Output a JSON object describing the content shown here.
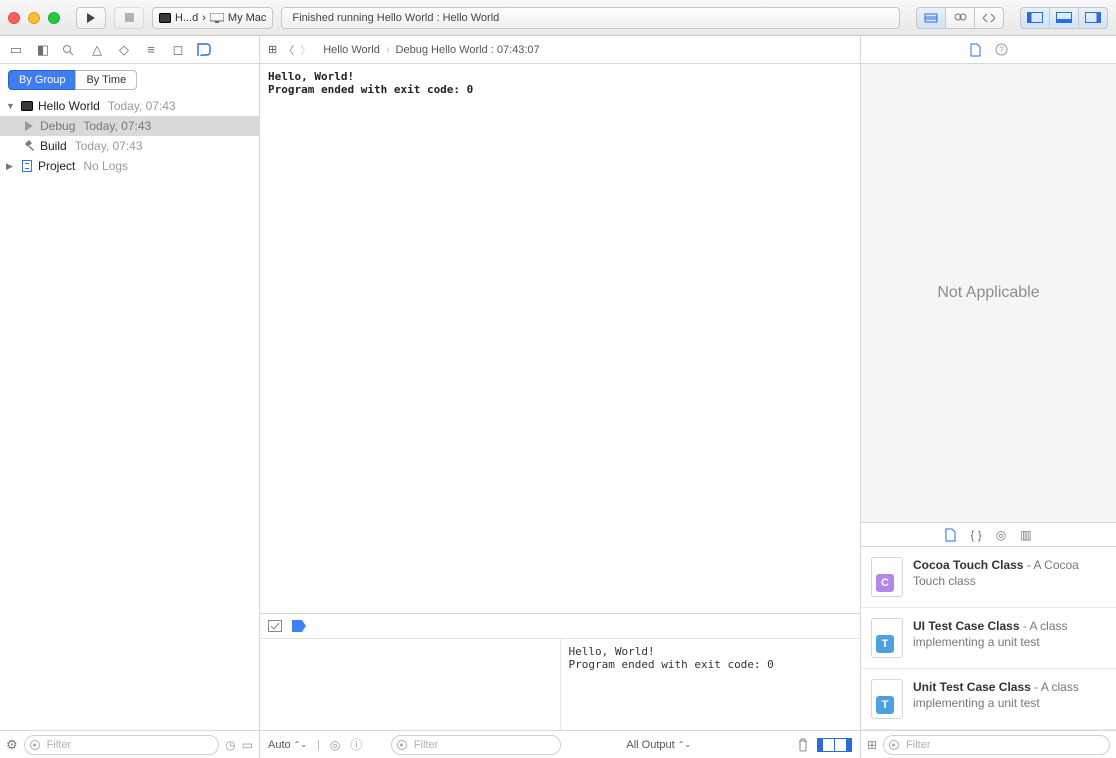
{
  "toolbar": {
    "scheme_project": "H...d",
    "scheme_destination": "My Mac",
    "status": "Finished running Hello World : Hello World"
  },
  "navigator": {
    "seg_group": "By Group",
    "seg_time": "By Time",
    "items": [
      {
        "label": "Hello World",
        "meta": "Today, 07:43",
        "icon": "terminal",
        "expanded": true,
        "children": [
          {
            "label": "Debug",
            "meta": "Today, 07:43",
            "icon": "play",
            "selected": true
          },
          {
            "label": "Build",
            "meta": "Today, 07:43",
            "icon": "hammer"
          }
        ]
      },
      {
        "label": "Project",
        "meta": "No Logs",
        "icon": "doc",
        "expanded": false
      }
    ],
    "filter_placeholder": "Filter"
  },
  "jumpbar": {
    "project": "Hello World",
    "item": "Debug Hello World : 07:43:07"
  },
  "console": {
    "line1": "Hello, World!",
    "line2": "Program ended with exit code: 0"
  },
  "debug_out": {
    "line1": "Hello, World!",
    "line2": "Program ended with exit code: 0"
  },
  "debug_footer": {
    "scope": "Auto",
    "filter_placeholder": "Filter",
    "output": "All Output"
  },
  "inspector": {
    "placeholder": "Not Applicable",
    "library": [
      {
        "glyph": "C",
        "color": "purple",
        "title": "Cocoa Touch Class",
        "desc": " - A Cocoa Touch class"
      },
      {
        "glyph": "T",
        "color": "blue",
        "title": "UI Test Case Class",
        "desc": " - A class implementing a unit test"
      },
      {
        "glyph": "T",
        "color": "blue",
        "title": "Unit Test Case Class",
        "desc": " - A class implementing a unit test"
      }
    ],
    "filter_placeholder": "Filter"
  }
}
